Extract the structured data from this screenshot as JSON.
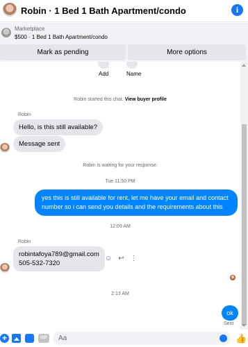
{
  "header": {
    "title": "Robin · 1 Bed 1 Bath Apartment/condo",
    "info_glyph": "i"
  },
  "marketplace": {
    "label": "Marketplace",
    "listing": "$500 · 1 Bed 1 Bath Apartment/condo"
  },
  "actions": {
    "mark_pending": "Mark as pending",
    "more_options": "More options"
  },
  "profile_options": [
    {
      "label": "Add",
      "icon": "add-icon"
    },
    {
      "label": "Name",
      "icon": "name-icon"
    }
  ],
  "chat": {
    "started_text": "Robin started this chat.",
    "view_profile": "View buyer profile",
    "sender_name": "Robin",
    "messages_in_1": [
      "Hello, is this still available?",
      "Message sent"
    ],
    "waiting_text": "Robin is waiting for your response.",
    "time_1": "Tue 11:50 PM",
    "outgoing_1": "yes this is still available for rent, let me have your email  and contact number so i can send you details and the requirements about this",
    "time_2": "12:09 AM",
    "sender_name_2": "Robin",
    "incoming_2_line1": "robintafoya789@gmail.com",
    "incoming_2_line2": "505-532-7320",
    "time_3": "2:13 AM",
    "outgoing_2": "ok",
    "sent_status": "Sent"
  },
  "composer": {
    "placeholder": "Aa",
    "gif_label": "GIF",
    "plus_glyph": "+"
  },
  "colors": {
    "accent": "#1877f2",
    "outgoing_bubble": "#0084ff",
    "incoming_bubble": "#e4e6eb"
  }
}
